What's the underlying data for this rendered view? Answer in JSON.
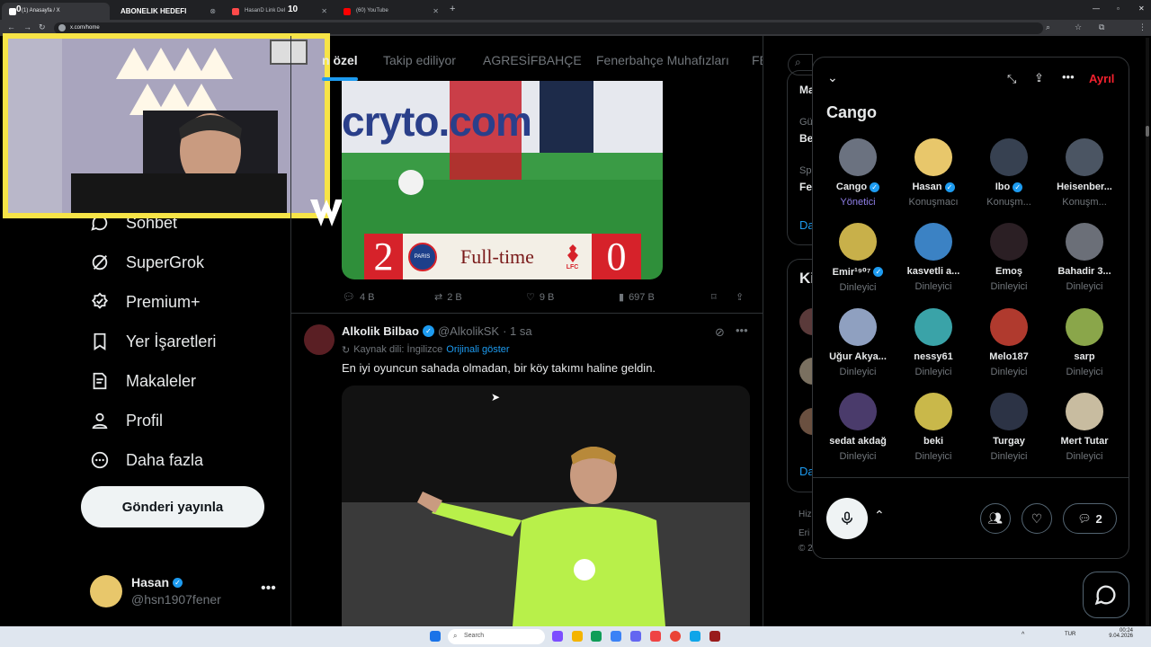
{
  "browser": {
    "tabs": [
      {
        "label": "(1) Anasayfa / X"
      },
      {
        "label": "ABONELIK HEDEFI"
      },
      {
        "label": "HasanD Link Del"
      },
      {
        "label": "(60) YouTube"
      }
    ],
    "overlay_counter": "10",
    "left_counter": "0",
    "url": "x.com/home"
  },
  "sidebar": {
    "items": [
      {
        "label": "Sohbet",
        "icon": "chat-icon"
      },
      {
        "label": "SuperGrok",
        "icon": "grok-icon"
      },
      {
        "label": "Premium+",
        "icon": "premium-icon"
      },
      {
        "label": "Yer İşaretleri",
        "icon": "bookmark-icon"
      },
      {
        "label": "Makaleler",
        "icon": "articles-icon"
      },
      {
        "label": "Profil",
        "icon": "profile-icon"
      },
      {
        "label": "Daha fazla",
        "icon": "more-icon"
      }
    ],
    "post_button": "Gönderi yayınla",
    "account": {
      "name": "Hasan",
      "handle": "@hsn1907fener"
    }
  },
  "feed": {
    "tabs": [
      "n özel",
      "Takip ediliyor",
      "AGRESİFBAHÇE",
      "Fenerbahçe Muhafızları",
      "FE"
    ],
    "post1": {
      "score_left": "2",
      "score_right": "0",
      "score_label": "Full-time",
      "left_club": "PARIS",
      "right_club": "LFC",
      "board_text": "cryto.com",
      "actions": {
        "replies": "4 B",
        "reposts": "2 B",
        "likes": "9 B",
        "views": "697 B"
      }
    },
    "post2": {
      "author": "Alkolik Bilbao",
      "handle": "@AlkolikSK",
      "time": "· 1 sa",
      "source_lang": "Kaynak dili: İngilizce",
      "show_original": "Orijinali göster",
      "text": "En iyi oyuncun sahada olmadan, bir köy takımı haline geldin."
    }
  },
  "right_col": {
    "fragments": [
      "Ma",
      "Gü",
      "Be",
      "Sp",
      "Fe",
      "Da",
      "Ki",
      "Da",
      "Hiz",
      "Eri",
      "© 2"
    ]
  },
  "space": {
    "leave_label": "Ayrıl",
    "title": "Cango",
    "participants": [
      {
        "name": "Cango",
        "role": "Yönetici",
        "verified": true,
        "color": "#6b7280"
      },
      {
        "name": "Hasan",
        "role": "Konuşmacı",
        "verified": true,
        "color": "#e8c76b"
      },
      {
        "name": "Ibo",
        "role": "Konuşm...",
        "verified": true,
        "color": "#374151"
      },
      {
        "name": "Heisenber...",
        "role": "Konuşm...",
        "verified": false,
        "color": "#4b5563"
      },
      {
        "name": "Emir¹⁹⁰⁷",
        "role": "Dinleyici",
        "verified": true,
        "color": "#c8b04a"
      },
      {
        "name": "kasvetli a...",
        "role": "Dinleyici",
        "verified": false,
        "color": "#3b82c4"
      },
      {
        "name": "Emoş",
        "role": "Dinleyici",
        "verified": false,
        "color": "#2b1f24"
      },
      {
        "name": "Bahadir 3...",
        "role": "Dinleyici",
        "verified": false,
        "color": "#6b6f78"
      },
      {
        "name": "Uğur Akya...",
        "role": "Dinleyici",
        "verified": false,
        "color": "#8fa0c0"
      },
      {
        "name": "nessy61",
        "role": "Dinleyici",
        "verified": false,
        "color": "#3aa3a8"
      },
      {
        "name": "Melo187",
        "role": "Dinleyici",
        "verified": false,
        "color": "#b03a2e"
      },
      {
        "name": "sarp",
        "role": "Dinleyici",
        "verified": false,
        "color": "#8aa64a"
      },
      {
        "name": "sedat akdağ",
        "role": "Dinleyici",
        "verified": false,
        "color": "#4a3b6b"
      },
      {
        "name": "beki",
        "role": "Dinleyici",
        "verified": false,
        "color": "#c9b84a"
      },
      {
        "name": "Turgay",
        "role": "Dinleyici",
        "verified": false,
        "color": "#2c3345"
      },
      {
        "name": "Mert Tutar",
        "role": "Dinleyici",
        "verified": false,
        "color": "#c8bca0"
      }
    ],
    "comment_count": "2"
  },
  "taskbar": {
    "search_placeholder": "Search",
    "lang": "TUR",
    "time": "00:24",
    "date": "9.04.2026"
  }
}
